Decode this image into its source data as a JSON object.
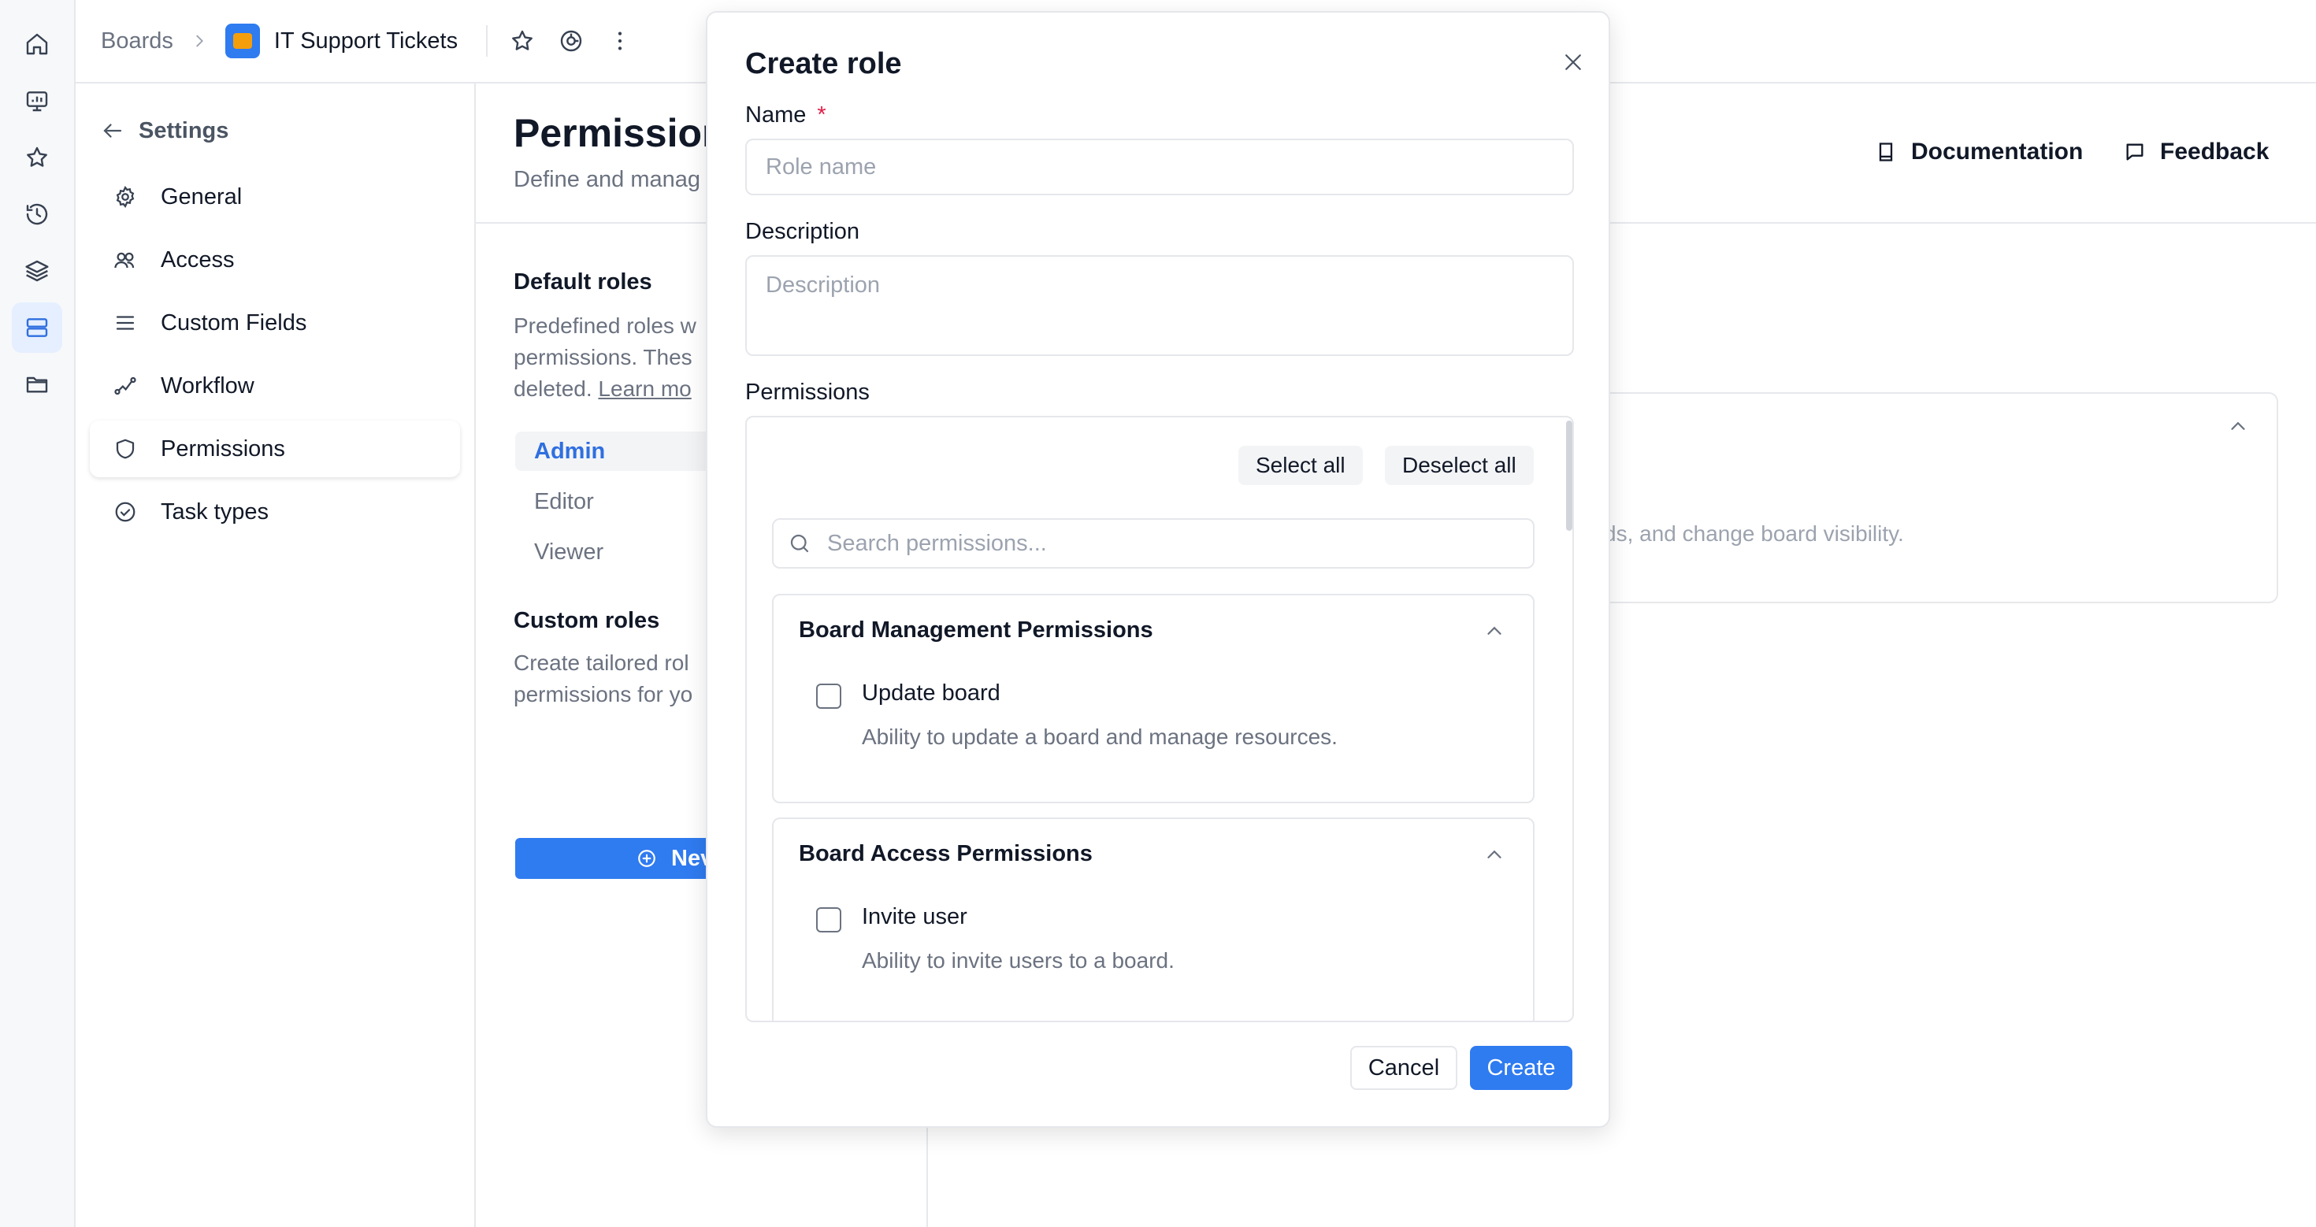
{
  "colors": {
    "accent": "#2f7bf0",
    "required": "#e11d48"
  },
  "rail": {
    "items": [
      {
        "icon": "home-icon"
      },
      {
        "icon": "dashboard-icon"
      },
      {
        "icon": "star-icon"
      },
      {
        "icon": "history-icon"
      },
      {
        "icon": "layers-icon"
      },
      {
        "icon": "boards-icon",
        "active": true
      },
      {
        "icon": "folder-icon"
      }
    ]
  },
  "topbar": {
    "breadcrumb_root": "Boards",
    "board_name": "IT Support Tickets",
    "icons": [
      "star-icon",
      "watch-icon",
      "more-vertical-icon"
    ]
  },
  "settings_nav": {
    "back_label": "Settings",
    "items": [
      {
        "label": "General",
        "icon": "gear-icon"
      },
      {
        "label": "Access",
        "icon": "users-icon"
      },
      {
        "label": "Custom Fields",
        "icon": "list-icon"
      },
      {
        "label": "Workflow",
        "icon": "workflow-icon"
      },
      {
        "label": "Permissions",
        "icon": "shield-icon",
        "active": true
      },
      {
        "label": "Task types",
        "icon": "check-circle-icon"
      }
    ]
  },
  "main": {
    "title": "Permission",
    "subtitle": "Define and manag",
    "documentation_label": "Documentation",
    "feedback_label": "Feedback",
    "default_roles": {
      "title": "Default roles",
      "desc_line1": "Predefined roles w",
      "desc_line2": "permissions. Thes",
      "desc_line3": "deleted.",
      "learn_more": "Learn mo",
      "roles": [
        "Admin",
        "Editor",
        "Viewer"
      ]
    },
    "custom_roles": {
      "title": "Custom roles",
      "desc_line1": "Create tailored rol",
      "desc_line2": "permissions for yo",
      "new_button": "Nev"
    },
    "card_text": "ields, and change board visibility."
  },
  "modal": {
    "title": "Create role",
    "name_label": "Name",
    "required_mark": "*",
    "name_placeholder": "Role name",
    "description_label": "Description",
    "description_placeholder": "Description",
    "permissions_label": "Permissions",
    "select_all": "Select all",
    "deselect_all": "Deselect all",
    "search_placeholder": "Search permissions...",
    "groups": [
      {
        "title": "Board Management Permissions",
        "permissions": [
          {
            "name": "Update board",
            "description": "Ability to update a board and manage resources.",
            "checked": false
          }
        ]
      },
      {
        "title": "Board Access Permissions",
        "permissions": [
          {
            "name": "Invite user",
            "description": "Ability to invite users to a board.",
            "checked": false
          }
        ]
      }
    ],
    "cancel_label": "Cancel",
    "create_label": "Create"
  }
}
